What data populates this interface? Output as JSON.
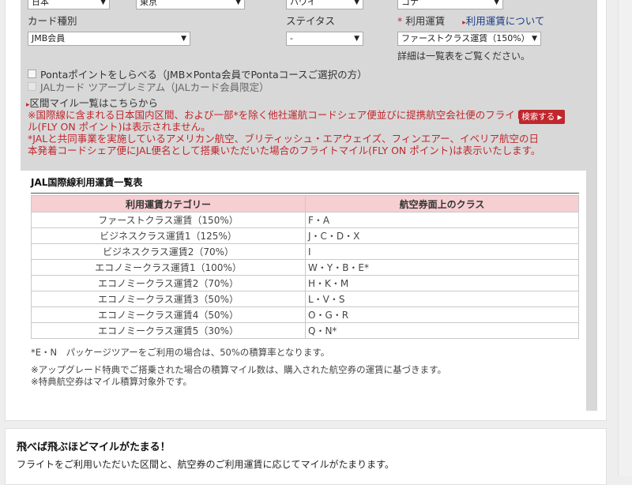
{
  "top_row": {
    "select1": "日本",
    "select2": "東京",
    "select3": "ハワイ",
    "select4": "コナ"
  },
  "form": {
    "card_type": {
      "label": "カード種別",
      "value": "JMB会員"
    },
    "status": {
      "label": "ステイタス",
      "value": "-"
    },
    "fare": {
      "required_mark": "*",
      "label": "利用運賃",
      "about_link": "利用運賃について",
      "value": "ファーストクラス運賃（150%）",
      "hint": "詳細は一覧表をご覧ください。"
    }
  },
  "checkboxes": [
    {
      "label": "Pontaポイントをしらべる（JMB×Ponta会員でPontaコースご選択の方）"
    },
    {
      "label": "JALカード ツアープレミアム（JALカード会員限定）"
    }
  ],
  "section_mile_link": "区間マイル一覧はこちらから",
  "notices": {
    "line1a": "※国際線に含まれる日本国内区間、および一部*を除く他社運航コードシェア便並びに提携航空会社便のフライトマイ",
    "line1b": "ル(FLY ON ポイント)は表示されません。",
    "line2a": "*JALと共同事業を実施しているアメリカン航空、ブリティッシュ・エアウェイズ、フィンエアー、イベリア航空の日",
    "line2b": "本発着コードシェア便にJAL便名として搭乗いただいた場合のフライトマイル(FLY ON ポイント)は表示いたします。"
  },
  "search_button": "検索する",
  "fare_table": {
    "title": "JAL国際線利用運賃一覧表",
    "headers": [
      "利用運賃カテゴリー",
      "航空券面上のクラス"
    ],
    "rows": [
      [
        "ファーストクラス運賃（150%）",
        "F・A"
      ],
      [
        "ビジネスクラス運賃1（125%）",
        "J・C・D・X"
      ],
      [
        "ビジネスクラス運賃2（70%）",
        "I"
      ],
      [
        "エコノミークラス運賃1（100%）",
        "W・Y・B・E*"
      ],
      [
        "エコノミークラス運賃2（70%）",
        "H・K・M"
      ],
      [
        "エコノミークラス運賃3（50%）",
        "L・V・S"
      ],
      [
        "エコノミークラス運賃4（50%）",
        "O・G・R"
      ],
      [
        "エコノミークラス運賃5（30%）",
        "Q・N*"
      ]
    ],
    "note1": "*E・N　パッケージツアーをご利用の場合は、50%の積算率となります。",
    "note2": "※アップグレード特典でご搭乗された場合の積算マイル数は、購入された航空券の運賃に基づきます。",
    "note3": "※特典航空券はマイル積算対象外です。"
  },
  "bottom_section": {
    "title": "飛べば飛ぶほどマイルがたまる！",
    "text": "フライトをご利用いただいた区間と、航空券のご利用運賃に応じてマイルがたまります。"
  },
  "colors": {
    "accent_red": "#c0272d",
    "link_blue": "#1a3c8c",
    "table_header_pink": "#f6cfd2",
    "form_background": "#d8d8d8"
  }
}
